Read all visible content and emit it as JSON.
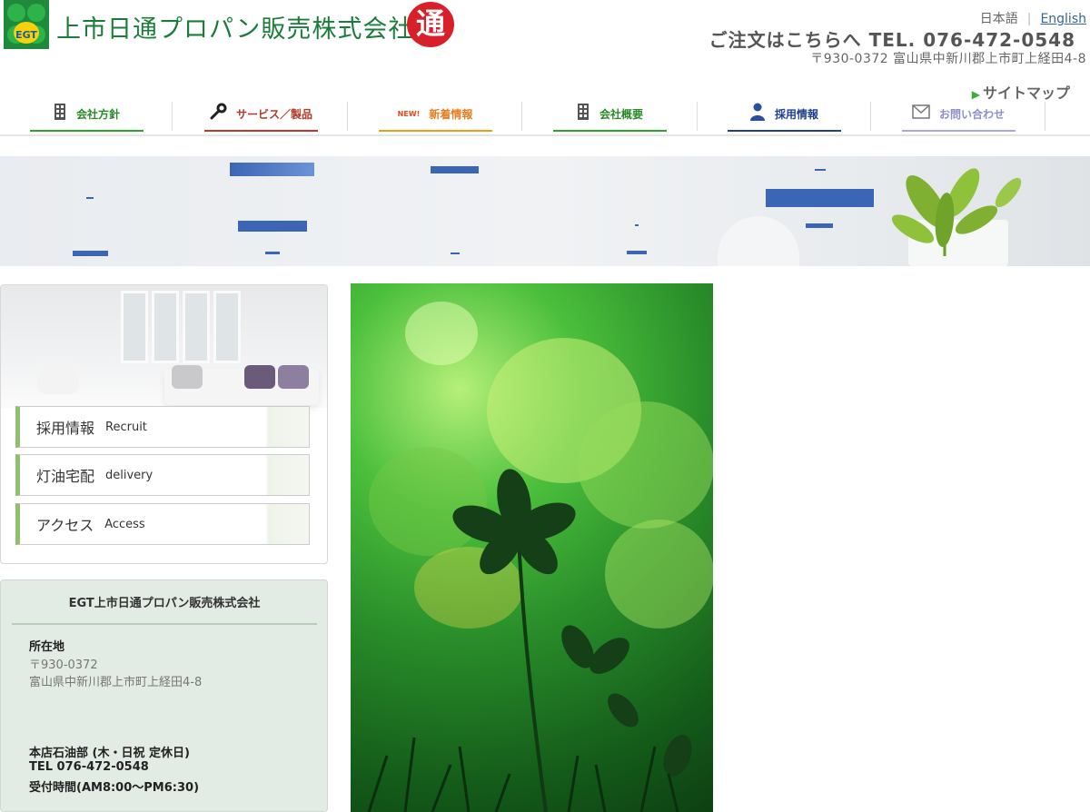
{
  "header": {
    "logo_mark_text": "EGT",
    "company_logo_text": "上市日通プロパン販売株式会社",
    "seal_char": "通",
    "lang_ja": "日本語",
    "lang_sep": "|",
    "lang_en": "English",
    "order_text": "ご注文はこちらへ TEL. 076-472-0548",
    "address": "〒930-0372 富山県中新川郡上市町上経田4-8",
    "sitemap": "サイトマップ"
  },
  "nav": {
    "items": [
      {
        "label": "会社方針",
        "color": "#2aa52a",
        "icon": "building-icon"
      },
      {
        "label": "サービス／製品",
        "color": "#c0392b",
        "icon": "wrench-icon"
      },
      {
        "label": "新着情報",
        "color": "#f39c12",
        "icon": "new-badge-icon",
        "badge": "NEW!"
      },
      {
        "label": "会社概要",
        "color": "#2aa52a",
        "icon": "building-icon"
      },
      {
        "label": "採用情報",
        "color": "#1f3f8f",
        "icon": "person-icon"
      },
      {
        "label": "お問い合わせ",
        "color": "#8e8ecf",
        "icon": "mail-icon"
      }
    ]
  },
  "sidebar": {
    "links": [
      {
        "jp": "採用情報",
        "en": "Recruit"
      },
      {
        "jp": "灯油宅配",
        "en": "delivery"
      },
      {
        "jp": "アクセス",
        "en": "Access"
      }
    ]
  },
  "info": {
    "company": "EGT上市日通プロパン販売株式会社",
    "location_label": "所在地",
    "postal": "〒930-0372",
    "address": "富山県中新川郡上市町上経田4-8",
    "dept_label": "本店石油部 (木・日祝 定休日)",
    "tel": "TEL 076-472-0548",
    "hours": "受付時間(AM8:00～PM6:30)"
  },
  "colors": {
    "brand_green": "#1c7d3a",
    "seal_red": "#d8202a",
    "link_blue": "#336699",
    "banner_bar": "#3b66b5"
  }
}
